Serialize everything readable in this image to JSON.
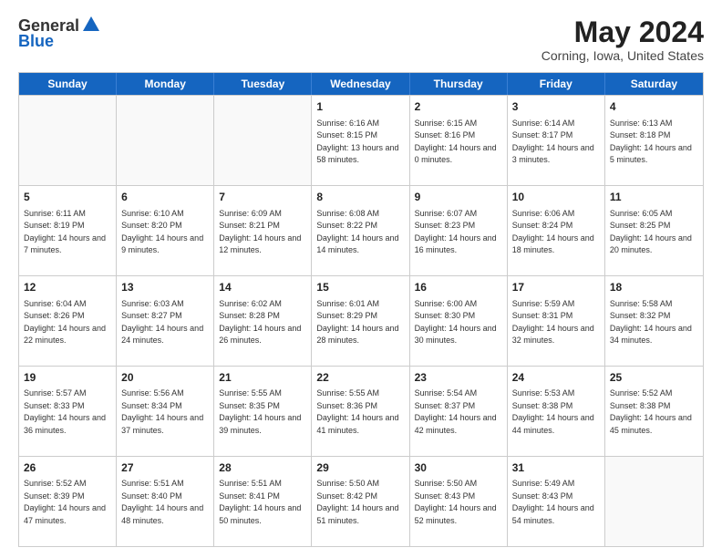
{
  "header": {
    "logo_line1": "General",
    "logo_line2": "Blue",
    "month": "May 2024",
    "location": "Corning, Iowa, United States"
  },
  "days_of_week": [
    "Sunday",
    "Monday",
    "Tuesday",
    "Wednesday",
    "Thursday",
    "Friday",
    "Saturday"
  ],
  "weeks": [
    [
      {
        "day": "",
        "sunrise": "",
        "sunset": "",
        "daylight": ""
      },
      {
        "day": "",
        "sunrise": "",
        "sunset": "",
        "daylight": ""
      },
      {
        "day": "",
        "sunrise": "",
        "sunset": "",
        "daylight": ""
      },
      {
        "day": "1",
        "sunrise": "Sunrise: 6:16 AM",
        "sunset": "Sunset: 8:15 PM",
        "daylight": "Daylight: 13 hours and 58 minutes."
      },
      {
        "day": "2",
        "sunrise": "Sunrise: 6:15 AM",
        "sunset": "Sunset: 8:16 PM",
        "daylight": "Daylight: 14 hours and 0 minutes."
      },
      {
        "day": "3",
        "sunrise": "Sunrise: 6:14 AM",
        "sunset": "Sunset: 8:17 PM",
        "daylight": "Daylight: 14 hours and 3 minutes."
      },
      {
        "day": "4",
        "sunrise": "Sunrise: 6:13 AM",
        "sunset": "Sunset: 8:18 PM",
        "daylight": "Daylight: 14 hours and 5 minutes."
      }
    ],
    [
      {
        "day": "5",
        "sunrise": "Sunrise: 6:11 AM",
        "sunset": "Sunset: 8:19 PM",
        "daylight": "Daylight: 14 hours and 7 minutes."
      },
      {
        "day": "6",
        "sunrise": "Sunrise: 6:10 AM",
        "sunset": "Sunset: 8:20 PM",
        "daylight": "Daylight: 14 hours and 9 minutes."
      },
      {
        "day": "7",
        "sunrise": "Sunrise: 6:09 AM",
        "sunset": "Sunset: 8:21 PM",
        "daylight": "Daylight: 14 hours and 12 minutes."
      },
      {
        "day": "8",
        "sunrise": "Sunrise: 6:08 AM",
        "sunset": "Sunset: 8:22 PM",
        "daylight": "Daylight: 14 hours and 14 minutes."
      },
      {
        "day": "9",
        "sunrise": "Sunrise: 6:07 AM",
        "sunset": "Sunset: 8:23 PM",
        "daylight": "Daylight: 14 hours and 16 minutes."
      },
      {
        "day": "10",
        "sunrise": "Sunrise: 6:06 AM",
        "sunset": "Sunset: 8:24 PM",
        "daylight": "Daylight: 14 hours and 18 minutes."
      },
      {
        "day": "11",
        "sunrise": "Sunrise: 6:05 AM",
        "sunset": "Sunset: 8:25 PM",
        "daylight": "Daylight: 14 hours and 20 minutes."
      }
    ],
    [
      {
        "day": "12",
        "sunrise": "Sunrise: 6:04 AM",
        "sunset": "Sunset: 8:26 PM",
        "daylight": "Daylight: 14 hours and 22 minutes."
      },
      {
        "day": "13",
        "sunrise": "Sunrise: 6:03 AM",
        "sunset": "Sunset: 8:27 PM",
        "daylight": "Daylight: 14 hours and 24 minutes."
      },
      {
        "day": "14",
        "sunrise": "Sunrise: 6:02 AM",
        "sunset": "Sunset: 8:28 PM",
        "daylight": "Daylight: 14 hours and 26 minutes."
      },
      {
        "day": "15",
        "sunrise": "Sunrise: 6:01 AM",
        "sunset": "Sunset: 8:29 PM",
        "daylight": "Daylight: 14 hours and 28 minutes."
      },
      {
        "day": "16",
        "sunrise": "Sunrise: 6:00 AM",
        "sunset": "Sunset: 8:30 PM",
        "daylight": "Daylight: 14 hours and 30 minutes."
      },
      {
        "day": "17",
        "sunrise": "Sunrise: 5:59 AM",
        "sunset": "Sunset: 8:31 PM",
        "daylight": "Daylight: 14 hours and 32 minutes."
      },
      {
        "day": "18",
        "sunrise": "Sunrise: 5:58 AM",
        "sunset": "Sunset: 8:32 PM",
        "daylight": "Daylight: 14 hours and 34 minutes."
      }
    ],
    [
      {
        "day": "19",
        "sunrise": "Sunrise: 5:57 AM",
        "sunset": "Sunset: 8:33 PM",
        "daylight": "Daylight: 14 hours and 36 minutes."
      },
      {
        "day": "20",
        "sunrise": "Sunrise: 5:56 AM",
        "sunset": "Sunset: 8:34 PM",
        "daylight": "Daylight: 14 hours and 37 minutes."
      },
      {
        "day": "21",
        "sunrise": "Sunrise: 5:55 AM",
        "sunset": "Sunset: 8:35 PM",
        "daylight": "Daylight: 14 hours and 39 minutes."
      },
      {
        "day": "22",
        "sunrise": "Sunrise: 5:55 AM",
        "sunset": "Sunset: 8:36 PM",
        "daylight": "Daylight: 14 hours and 41 minutes."
      },
      {
        "day": "23",
        "sunrise": "Sunrise: 5:54 AM",
        "sunset": "Sunset: 8:37 PM",
        "daylight": "Daylight: 14 hours and 42 minutes."
      },
      {
        "day": "24",
        "sunrise": "Sunrise: 5:53 AM",
        "sunset": "Sunset: 8:38 PM",
        "daylight": "Daylight: 14 hours and 44 minutes."
      },
      {
        "day": "25",
        "sunrise": "Sunrise: 5:52 AM",
        "sunset": "Sunset: 8:38 PM",
        "daylight": "Daylight: 14 hours and 45 minutes."
      }
    ],
    [
      {
        "day": "26",
        "sunrise": "Sunrise: 5:52 AM",
        "sunset": "Sunset: 8:39 PM",
        "daylight": "Daylight: 14 hours and 47 minutes."
      },
      {
        "day": "27",
        "sunrise": "Sunrise: 5:51 AM",
        "sunset": "Sunset: 8:40 PM",
        "daylight": "Daylight: 14 hours and 48 minutes."
      },
      {
        "day": "28",
        "sunrise": "Sunrise: 5:51 AM",
        "sunset": "Sunset: 8:41 PM",
        "daylight": "Daylight: 14 hours and 50 minutes."
      },
      {
        "day": "29",
        "sunrise": "Sunrise: 5:50 AM",
        "sunset": "Sunset: 8:42 PM",
        "daylight": "Daylight: 14 hours and 51 minutes."
      },
      {
        "day": "30",
        "sunrise": "Sunrise: 5:50 AM",
        "sunset": "Sunset: 8:43 PM",
        "daylight": "Daylight: 14 hours and 52 minutes."
      },
      {
        "day": "31",
        "sunrise": "Sunrise: 5:49 AM",
        "sunset": "Sunset: 8:43 PM",
        "daylight": "Daylight: 14 hours and 54 minutes."
      },
      {
        "day": "",
        "sunrise": "",
        "sunset": "",
        "daylight": ""
      }
    ]
  ]
}
